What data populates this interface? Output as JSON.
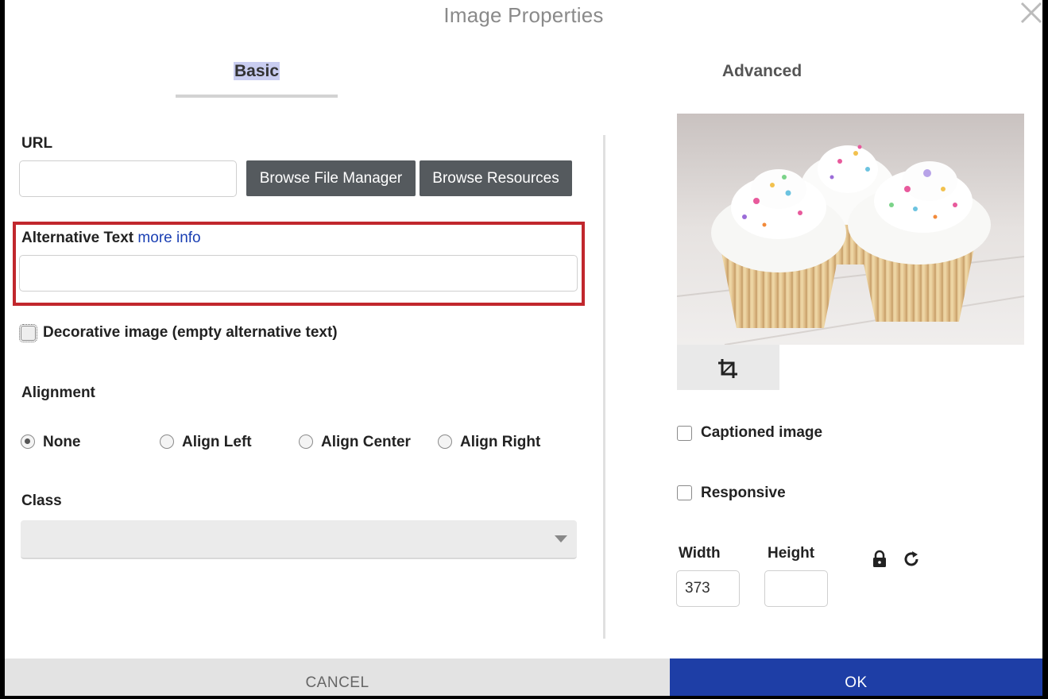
{
  "dialog": {
    "title": "Image Properties",
    "tabs": [
      {
        "label": "Basic",
        "active": true
      },
      {
        "label": "Advanced",
        "active": false
      }
    ]
  },
  "url": {
    "label": "URL",
    "value": "",
    "browse_file_manager": "Browse File Manager",
    "browse_resources": "Browse Resources"
  },
  "alt_text": {
    "label": "Alternative Text",
    "more_info": "more info",
    "value": ""
  },
  "decorative": {
    "label": "Decorative image (empty alternative text)",
    "checked": false
  },
  "alignment": {
    "label": "Alignment",
    "options": [
      {
        "label": "None",
        "checked": true
      },
      {
        "label": "Align Left",
        "checked": false
      },
      {
        "label": "Align Center",
        "checked": false
      },
      {
        "label": "Align Right",
        "checked": false
      }
    ]
  },
  "class_field": {
    "label": "Class",
    "value": ""
  },
  "preview": {
    "crop_icon": "crop-icon"
  },
  "captioned": {
    "label": "Captioned image",
    "checked": false
  },
  "responsive": {
    "label": "Responsive",
    "checked": false
  },
  "dimensions": {
    "width_label": "Width",
    "width_value": "373",
    "height_label": "Height",
    "height_value": "",
    "lock_icon": "lock-icon",
    "reset_icon": "reset-icon"
  },
  "footer": {
    "cancel": "CANCEL",
    "ok": "OK"
  },
  "colors": {
    "highlight": "#c1272d",
    "primary": "#1e3ea6",
    "dark_button": "#555a5e",
    "link": "#1a3fb3"
  }
}
